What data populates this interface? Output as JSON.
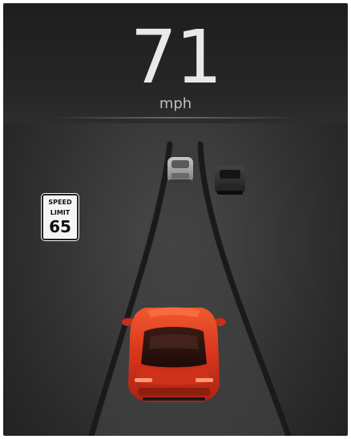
{
  "dashboard": {
    "speed": "71",
    "unit": "mph"
  },
  "speed_limit_sign": {
    "line1": "SPEED",
    "line2": "LIMIT",
    "value": "65"
  },
  "colors": {
    "ego_car": "#d8341c",
    "lead_car": "#9a9a9a",
    "adjacent_car": "#2e2e2e",
    "lane_line": "#1a1a1a",
    "background": "#333333"
  },
  "icons": {
    "ego_car": "ego-car-icon",
    "lead_car": "lead-vehicle-icon",
    "adjacent_car": "adjacent-vehicle-icon"
  }
}
